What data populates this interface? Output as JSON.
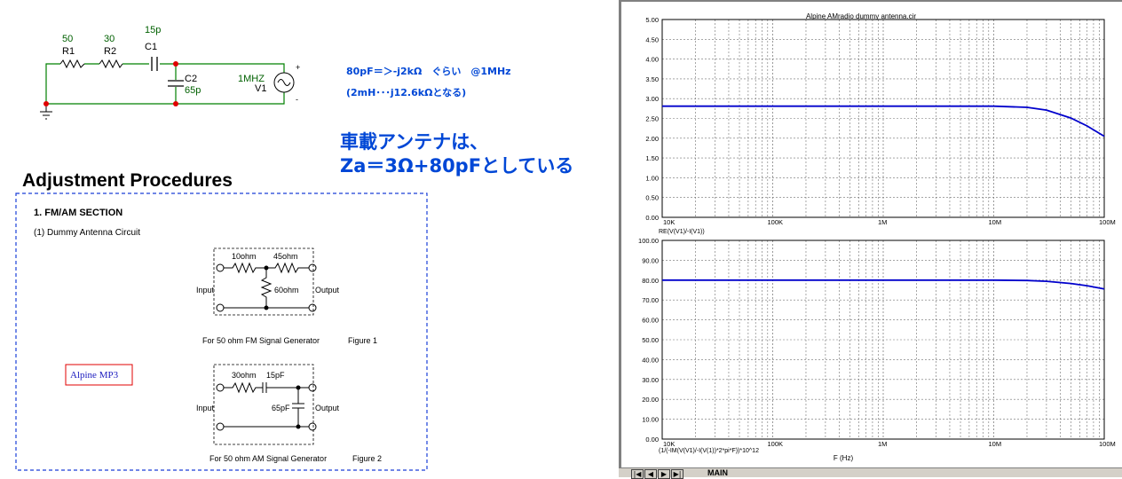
{
  "schematic": {
    "r1_value": "50",
    "r1_name": "R1",
    "r2_value": "30",
    "r2_name": "R2",
    "c1_value": "15p",
    "c1_name": "C1",
    "c2_name": "C2",
    "c2_value": "65p",
    "v1_freq": "1MHZ",
    "v1_name": "V1",
    "plus_sign": "+",
    "minus_sign": "-",
    "note_line1": "80pF＝＞-j2kΩ　ぐらい　@1MHz",
    "note_line2": "(2mH･･･j12.6kΩとなる)",
    "big_note_line1": "車載アンテナは、",
    "big_note_line2": "Za＝3Ω+80pFとしている",
    "accent_blue": "#0047d6",
    "wire_green": "#008000",
    "node_red": "#e00000"
  },
  "manual": {
    "heading": "Adjustment Procedures",
    "section": "1.  FM/AM SECTION",
    "subsection": "(1)  Dummy Antenna Circuit",
    "fig1": {
      "r_a": "10ohm",
      "r_b": "45ohm",
      "r_c": "60ohm",
      "input": "Input",
      "output": "Output",
      "caption": "For 50 ohm FM Signal Generator",
      "figure": "Figure 1"
    },
    "fig2": {
      "r_a": "30ohm",
      "c_a": "15pF",
      "c_b": "65pF",
      "input": "Input",
      "output": "Output",
      "caption": "For 50 ohm AM Signal Generator",
      "figure": "Figure 2"
    },
    "stamp": "Alpine MP3",
    "dash_blue": "#1a3fd8"
  },
  "plot": {
    "title": "Alpine AMradio dummy antenna.cir",
    "tab_label": "MAIN",
    "nav_icons": [
      "first-icon",
      "prev-icon",
      "next-icon",
      "last-icon"
    ],
    "trace_color": "#0000cc"
  },
  "chart_data": [
    {
      "type": "line",
      "title": "Alpine AMradio dummy antenna.cir",
      "xscale": "log",
      "xlim": [
        10000,
        100000000
      ],
      "ylim": [
        0,
        5
      ],
      "grid": true,
      "yticks": [
        "0.00",
        "0.50",
        "1.00",
        "1.50",
        "2.00",
        "2.50",
        "3.00",
        "3.50",
        "4.00",
        "4.50",
        "5.00"
      ],
      "xticks": [
        "10K",
        "100K",
        "1M",
        "10M",
        "100M"
      ],
      "xlabel": "",
      "ylabel": "RE(V(V1)/-I(V1))",
      "series": [
        {
          "name": "RE(V(V1)/-I(V1))",
          "x": [
            10000,
            100000,
            1000000,
            10000000,
            20000000,
            30000000,
            50000000,
            70000000,
            100000000
          ],
          "values": [
            2.81,
            2.81,
            2.81,
            2.81,
            2.78,
            2.71,
            2.51,
            2.31,
            2.05
          ]
        }
      ]
    },
    {
      "type": "line",
      "xscale": "log",
      "xlim": [
        10000,
        100000000
      ],
      "ylim": [
        0,
        100
      ],
      "grid": true,
      "yticks": [
        "0.00",
        "10.00",
        "20.00",
        "30.00",
        "40.00",
        "50.00",
        "60.00",
        "70.00",
        "80.00",
        "90.00",
        "100.00"
      ],
      "xticks": [
        "10K",
        "100K",
        "1M",
        "10M",
        "100M"
      ],
      "xlabel": "F (Hz)",
      "ylabel": "(1/(-IM(V(V1)/-I(V(1))*2*pi*F))*10^12",
      "series": [
        {
          "name": "(1/(-IM(V(V1)/-I(V(1))*2*pi*F))*10^12",
          "x": [
            10000,
            100000,
            1000000,
            10000000,
            20000000,
            30000000,
            50000000,
            70000000,
            100000000
          ],
          "values": [
            80.0,
            80.0,
            80.0,
            80.0,
            79.8,
            79.4,
            78.3,
            77.2,
            75.6
          ]
        }
      ]
    }
  ]
}
